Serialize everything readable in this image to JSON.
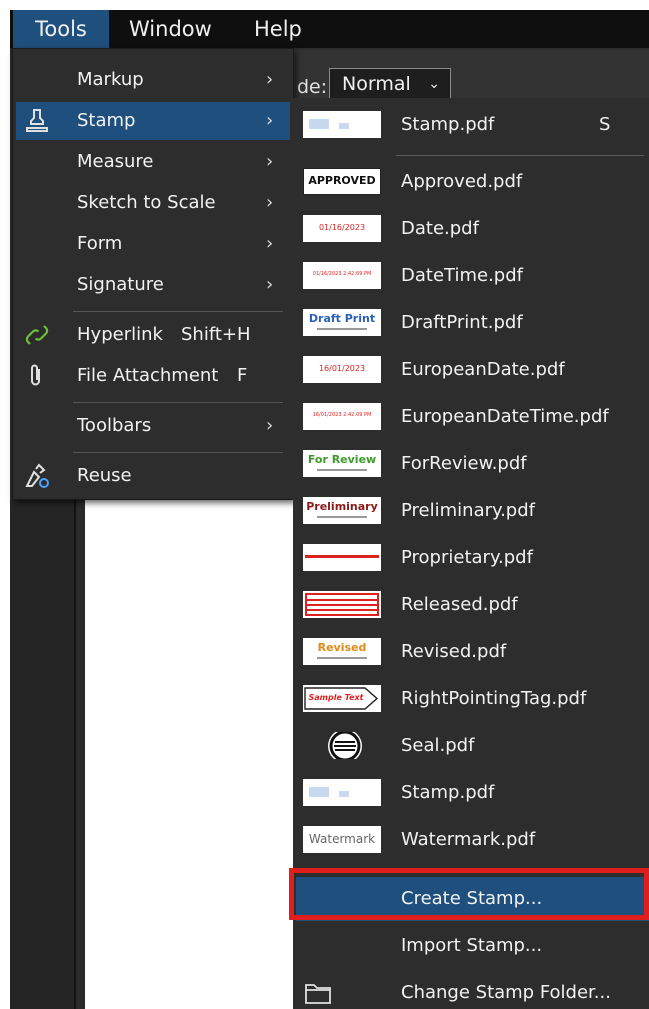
{
  "menubar": {
    "tools": "Tools",
    "window": "Window",
    "help": "Help"
  },
  "toolbar": {
    "mode_label": "de:",
    "mode_value": "Normal"
  },
  "tools_menu": {
    "markup": "Markup",
    "stamp": "Stamp",
    "measure": "Measure",
    "sketch": "Sketch to Scale",
    "form": "Form",
    "signature": "Signature",
    "hyperlink": "Hyperlink",
    "hyperlink_sc": "Shift+H",
    "file_attachment": "File Attachment",
    "file_attachment_sc": "F",
    "toolbars": "Toolbars",
    "reuse": "Reuse"
  },
  "stamp_menu": {
    "recent": "Stamp.pdf",
    "recent_sc": "S",
    "items": [
      "Approved.pdf",
      "Date.pdf",
      "DateTime.pdf",
      "DraftPrint.pdf",
      "EuropeanDate.pdf",
      "EuropeanDateTime.pdf",
      "ForReview.pdf",
      "Preliminary.pdf",
      "Proprietary.pdf",
      "Released.pdf",
      "Revised.pdf",
      "RightPointingTag.pdf",
      "Seal.pdf",
      "Stamp.pdf",
      "Watermark.pdf"
    ],
    "create": "Create Stamp...",
    "import": "Import Stamp...",
    "change_folder": "Change Stamp Folder..."
  },
  "thumbs": {
    "approved": "APPROVED",
    "date": "01/16/2023",
    "datetime": "01/16/2023 2:42:09 PM",
    "draft": "Draft Print",
    "eurodate": "16/01/2023",
    "eurodatetime": "16/01/2023 2:42:09 PM",
    "review": "For Review",
    "preliminary": "Preliminary",
    "revised": "Revised",
    "tag": "Sample Text",
    "watermark": "Watermark"
  },
  "colors": {
    "highlight": "#1f4f7d",
    "menu_bg": "#2d2d2d",
    "annotation": "#e01e1e"
  }
}
